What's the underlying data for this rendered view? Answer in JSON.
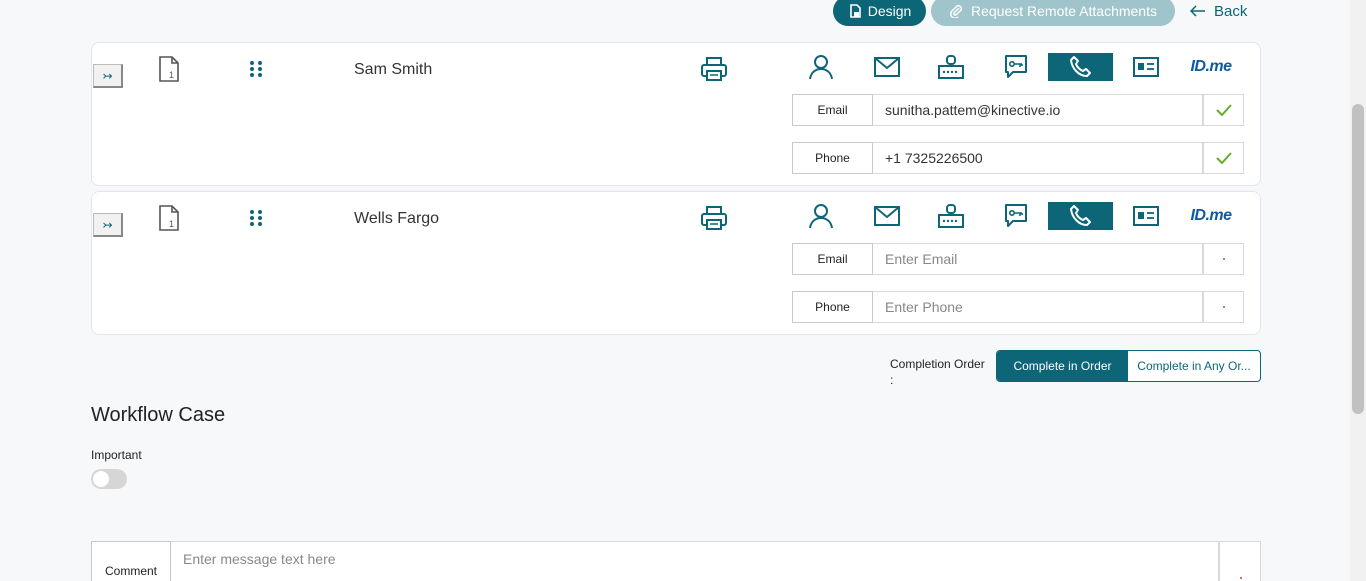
{
  "toolbar": {
    "design_label": "Design",
    "remote_label": "Request Remote Attachments",
    "back_label": "Back"
  },
  "signers": [
    {
      "name": "Sam Smith",
      "fields": [
        {
          "label": "Email",
          "value": "sunitha.pattem@kinective.io",
          "placeholder": "Enter Email",
          "status": "verified"
        },
        {
          "label": "Phone",
          "value": "+1 7325226500",
          "placeholder": "Enter Phone",
          "status": "verified"
        }
      ]
    },
    {
      "name": "Wells Fargo",
      "fields": [
        {
          "label": "Email",
          "value": "",
          "placeholder": "Enter Email",
          "status": "required"
        },
        {
          "label": "Phone",
          "value": "",
          "placeholder": "Enter Phone",
          "status": "required"
        }
      ]
    }
  ],
  "methods": [
    "person-icon",
    "mail-icon",
    "router-icon",
    "chat-key-icon",
    "phone-icon",
    "id-card-icon",
    "idme-logo"
  ],
  "idme_logo_text": "ID.me",
  "active_method": "phone-icon",
  "expand_glyph": "↣",
  "completion": {
    "label": "Completion Order",
    "colon": ":",
    "options": [
      "Complete in Order",
      "Complete in Any Or..."
    ],
    "selected": "Complete in Order"
  },
  "workflow": {
    "title": "Workflow Case",
    "important_label": "Important",
    "important_on": false
  },
  "comment": {
    "label": "Comment",
    "placeholder": "Enter message text here"
  },
  "colors": {
    "accent": "#0d6677",
    "accent_light": "#9fc4cc",
    "check": "#6aaa2a",
    "required": "#d33"
  }
}
